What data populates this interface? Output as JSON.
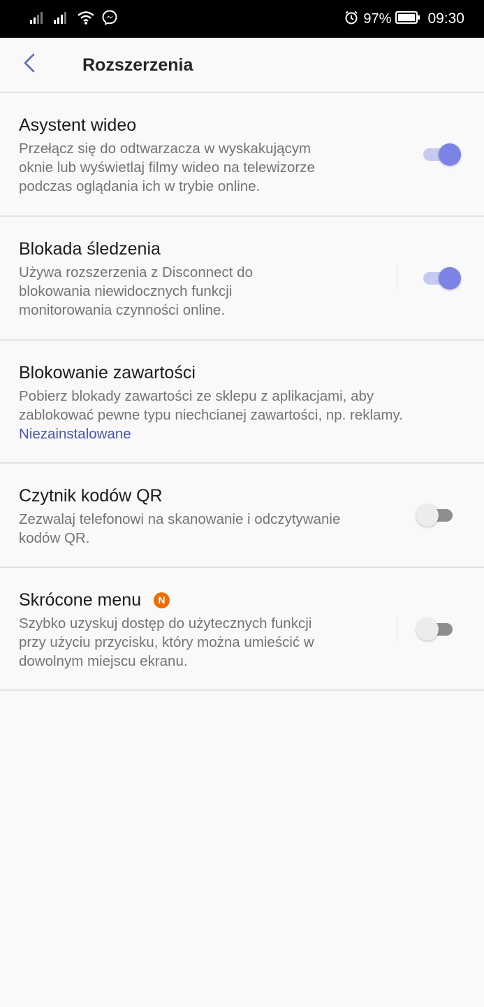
{
  "status_bar": {
    "battery": "97%",
    "time": "09:30"
  },
  "header": {
    "title": "Rozszerzenia"
  },
  "settings": [
    {
      "title": "Asystent wideo",
      "description_lines": [
        "Przełącz się do odtwarzacza w wyskakującym",
        "oknie lub wyświetlaj filmy wideo na telewizorze",
        "podczas oglądania ich w trybie online."
      ],
      "enabled": true
    },
    {
      "title": "Blokada śledzenia",
      "description_lines": [
        "Używa rozszerzenia z Disconnect do",
        "blokowania niewidocznych funkcji",
        "monitorowania czynności online."
      ],
      "enabled": true
    },
    {
      "title": "Blokowanie zawartości",
      "description_lines": [
        "Pobierz blokady zawartości ze sklepu z aplikacjami, aby",
        "zablokować pewne typu niechcianej zawartości, np. reklamy."
      ],
      "status": "Niezainstalowane"
    },
    {
      "title": "Czytnik kodów QR",
      "description_lines": [
        "Zezwalaj telefonowi na skanowanie i odczytywanie",
        "kodów QR."
      ],
      "enabled": false
    },
    {
      "title": "Skrócone menu",
      "badge": "N",
      "description_lines": [
        "Szybko uzyskuj dostęp do użytecznych funkcji",
        "przy użyciu przycisku, który można umieścić w",
        "dowolnym miejscu ekranu."
      ],
      "enabled": false
    }
  ],
  "colors": {
    "accent": "#7b83e4",
    "link": "#4a55b5",
    "badge": "#ef6c00"
  }
}
